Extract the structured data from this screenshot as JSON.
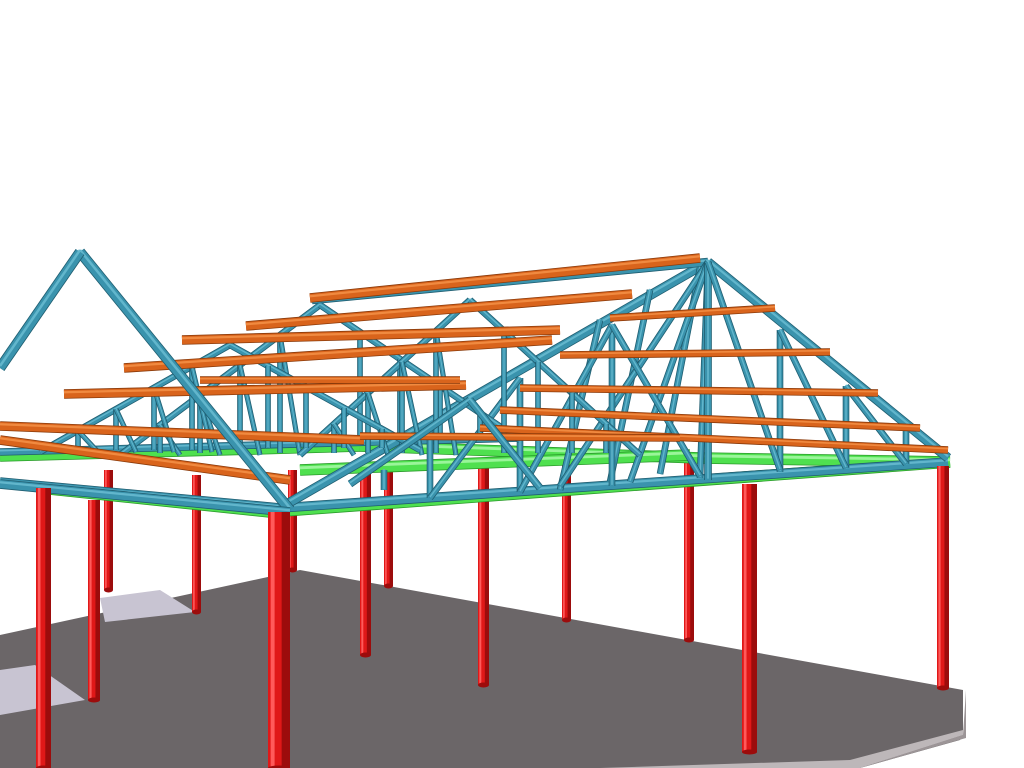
{
  "viewport": {
    "background": "#ffffff"
  },
  "model": {
    "colors": {
      "column": "#e01818",
      "column_shade": "#9c0c0c",
      "column_light": "#ff5a5a",
      "truss": "#3a93ad",
      "truss_dark": "#1f5d70",
      "truss_light": "#62b6cc",
      "purlin": "#d9641c",
      "purlin_dark": "#8a3a0a",
      "purlin_light": "#f08a40",
      "beam": "#4fe04f",
      "beam_dark": "#2a9a2a",
      "slab_top": "#6b6668",
      "slab_side": "#9c9597",
      "slab_light": "#c8c4d2",
      "slab_edge": "#bdb7b9"
    },
    "elements": [
      "floor-slab",
      "steel-columns",
      "ring-beams",
      "roof-trusses",
      "purlins"
    ]
  }
}
